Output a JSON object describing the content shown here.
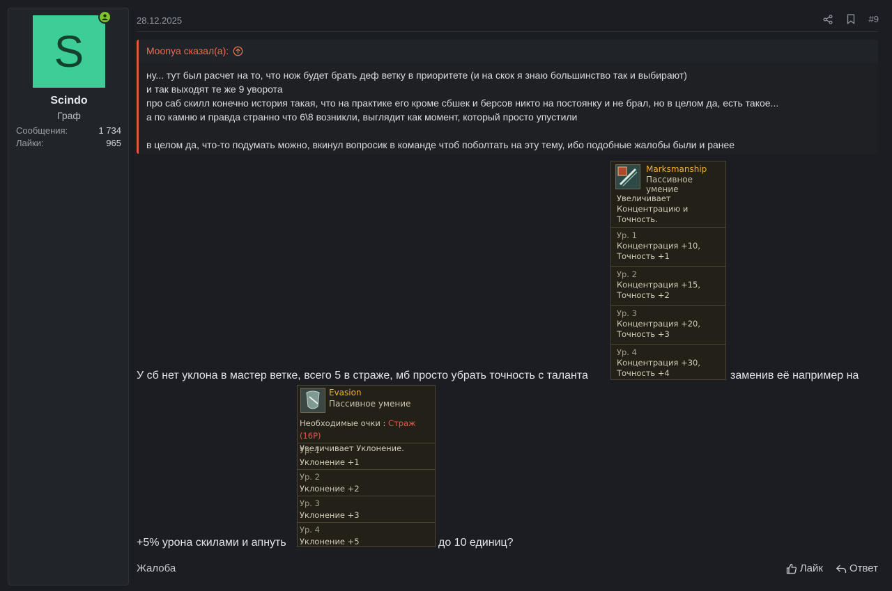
{
  "user": {
    "avatar_letter": "S",
    "name": "Scindo",
    "title": "Граф",
    "stats": [
      {
        "label": "Сообщения:",
        "value": "1 734"
      },
      {
        "label": "Лайки:",
        "value": "965"
      }
    ],
    "avatar_color": "#3cce96",
    "online_color": "#7cc52b"
  },
  "post": {
    "date": "28.12.2025",
    "number": "#9"
  },
  "quote": {
    "author": "Moonya сказал(а):",
    "lines": [
      "ну... тут был расчет на то, что нож будет брать деф ветку в приоритете (и на скок я знаю большинство так и выбирают)",
      "и так выходят те же 9 уворота",
      "про саб скилл конечно история такая, что на практике его кроме сбшек и берсов никто на постоянку и не брал, но в целом да, есть такое...",
      "а по камню и правда странно что 6\\8 возникли, выглядит как момент, который просто упустили",
      "в целом да, что-то подумать можно, вкинул вопросик в команде чтоб поболтать на эту тему, ибо подобные жалобы были и ранее"
    ],
    "accent_color": "#e0573b"
  },
  "message": {
    "line1_before": "У сб нет уклона в мастер ветке, всего 5 в страже, мб просто убрать точность с таланта",
    "line1_after": "заменив её например на",
    "line2_before": "+5% урона скилами и апнуть",
    "line2_after": "до 10 единиц?"
  },
  "tooltip_marksmanship": {
    "name": "Marksmanship",
    "type": "Пассивное умение",
    "desc": [
      "Увеличивает",
      "Концентрацию и",
      "Точность."
    ],
    "levels": [
      {
        "lvl": "Ур. 1",
        "l1": "Концентрация +10,",
        "l2": "Точность +1"
      },
      {
        "lvl": "Ур. 2",
        "l1": "Концентрация +15,",
        "l2": "Точность +2"
      },
      {
        "lvl": "Ур. 3",
        "l1": "Концентрация +20,",
        "l2": "Точность +3"
      },
      {
        "lvl": "Ур. 4",
        "l1": "Концентрация +30,",
        "l2": "Точность +4"
      }
    ]
  },
  "tooltip_evasion": {
    "name": "Evasion",
    "type": "Пассивное умение",
    "req_label": "Необходимые очки :",
    "req_value": "Страж (16Р)",
    "desc": "Увеличивает Уклонение.",
    "levels": [
      {
        "lvl": "Ур. 1",
        "l1": "Уклонение +1"
      },
      {
        "lvl": "Ур. 2",
        "l1": "Уклонение +2"
      },
      {
        "lvl": "Ур. 3",
        "l1": "Уклонение +3"
      },
      {
        "lvl": "Ур. 4",
        "l1": "Уклонение +5"
      }
    ],
    "tooltip_name_color": "#f0b331"
  },
  "footer": {
    "report": "Жалоба",
    "like": "Лайк",
    "reply": "Ответ"
  }
}
